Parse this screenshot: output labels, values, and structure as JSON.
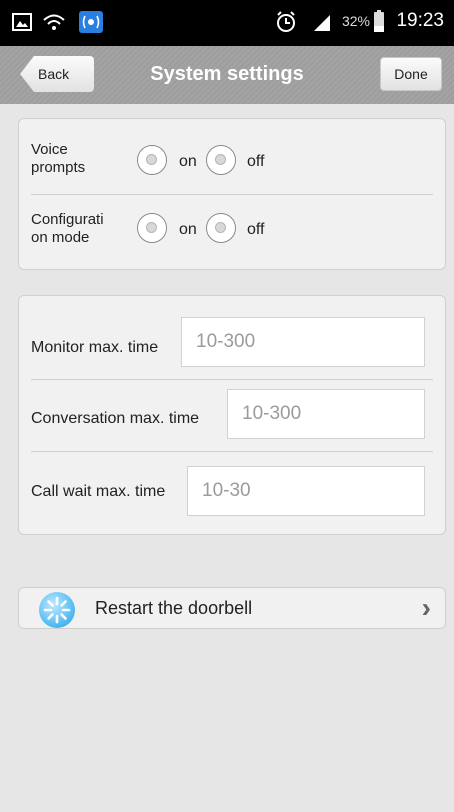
{
  "status_bar": {
    "battery_text": "32%",
    "time": "19:23",
    "icons": [
      "image-icon",
      "wifi-icon",
      "signal-app-icon",
      "alarm-icon",
      "cell-signal-icon",
      "battery-icon"
    ]
  },
  "header": {
    "back_label": "Back",
    "title": "System settings",
    "done_label": "Done"
  },
  "settings": {
    "voice_prompts": {
      "label": "Voice\nprompts",
      "on": "on",
      "off": "off",
      "selected": "none"
    },
    "configuration_mode": {
      "label": "Configurati\non mode",
      "on": "on",
      "off": "off",
      "selected": "none"
    }
  },
  "times": {
    "monitor": {
      "label": "Monitor max. time",
      "placeholder": "10-300",
      "value": ""
    },
    "conversation": {
      "label": "Conversation max. time",
      "placeholder": "10-300",
      "value": ""
    },
    "call_wait": {
      "label": "Call wait max. time",
      "placeholder": "10-30",
      "value": ""
    }
  },
  "restart": {
    "label": "Restart the doorbell",
    "icon": "restart-icon"
  },
  "colors": {
    "title_bar": "#a0a0a0",
    "background": "#e6e6e6",
    "accent": "#4bb7f1"
  }
}
